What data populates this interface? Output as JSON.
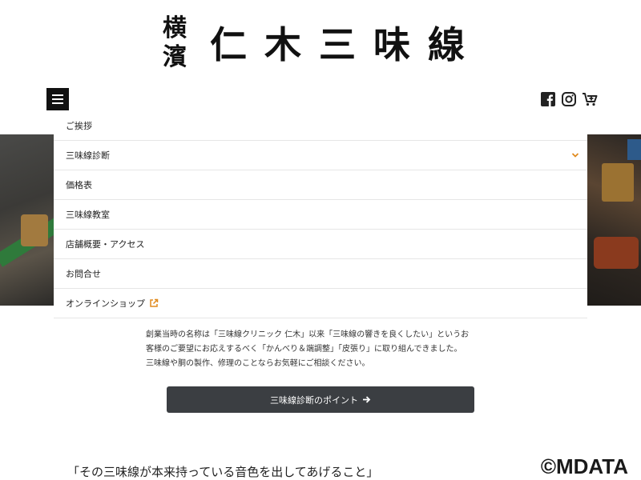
{
  "logo": {
    "prefix_top": "横",
    "prefix_bottom": "濱",
    "main": "仁木三味線"
  },
  "navbar": {
    "menu_icon": "hamburger-menu-icon",
    "social_icons": [
      "facebook-icon",
      "instagram-icon",
      "cart-icon"
    ]
  },
  "menu": {
    "items": [
      {
        "label": "ご挨拶"
      },
      {
        "label": "三味線診断"
      },
      {
        "label": "価格表"
      },
      {
        "label": "三味線教室"
      },
      {
        "label": "店舗概要・アクセス"
      },
      {
        "label": "お問合せ"
      },
      {
        "label": "オンラインショップ"
      }
    ],
    "accent_color": "#e08a1e"
  },
  "intro": {
    "line1": "創業当時の名称は「三味線クリニック 仁木」以来「三味線の響きを良くしたい」というお",
    "line2": "客様のご要望にお応えするべく「かんべり＆端調整」「皮張り」に取り組んできました。",
    "line3": "三味線や胴の製作、修理のことならお気軽にご相談ください。"
  },
  "cta": {
    "label": "三味線診断のポイント"
  },
  "quote": {
    "text": "「その三味線が本来持っている音色を出してあげること」"
  },
  "watermark": {
    "text": "©MDATA"
  }
}
